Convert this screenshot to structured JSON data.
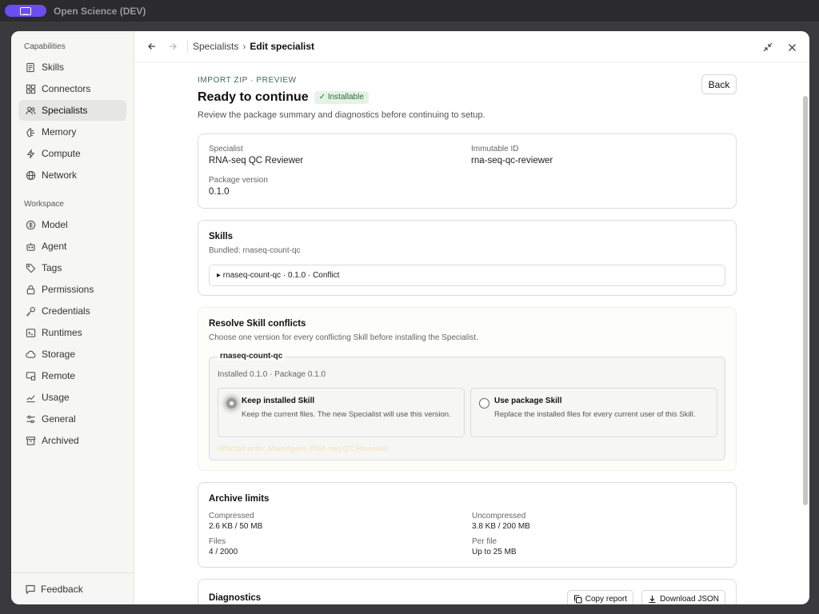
{
  "os": {
    "title": "Open Science (DEV)"
  },
  "sidebar": {
    "capabilities_label": "Capabilities",
    "capabilities": [
      {
        "label": "Skills",
        "icon": "skills-icon"
      },
      {
        "label": "Connectors",
        "icon": "connectors-icon"
      },
      {
        "label": "Specialists",
        "icon": "specialists-icon",
        "active": true
      },
      {
        "label": "Memory",
        "icon": "memory-icon"
      },
      {
        "label": "Compute",
        "icon": "compute-icon"
      },
      {
        "label": "Network",
        "icon": "network-icon"
      }
    ],
    "workspace_label": "Workspace",
    "workspace": [
      {
        "label": "Model",
        "icon": "model-icon"
      },
      {
        "label": "Agent",
        "icon": "agent-icon"
      },
      {
        "label": "Tags",
        "icon": "tags-icon"
      },
      {
        "label": "Permissions",
        "icon": "permissions-icon"
      },
      {
        "label": "Credentials",
        "icon": "credentials-icon"
      },
      {
        "label": "Runtimes",
        "icon": "runtimes-icon"
      },
      {
        "label": "Storage",
        "icon": "storage-icon"
      },
      {
        "label": "Remote",
        "icon": "remote-icon"
      },
      {
        "label": "Usage",
        "icon": "usage-icon"
      },
      {
        "label": "General",
        "icon": "general-icon"
      },
      {
        "label": "Archived",
        "icon": "archived-icon"
      }
    ],
    "feedback_label": "Feedback"
  },
  "topbar": {
    "breadcrumb": [
      "Specialists",
      "Edit specialist"
    ]
  },
  "page": {
    "eyebrow": "IMPORT ZIP · PREVIEW",
    "title": "Ready to continue",
    "badge": "✓ Installable",
    "subtitle": "Review the package summary and diagnostics before continuing to setup.",
    "back_label": "Back"
  },
  "summary": {
    "specialist_label": "Specialist",
    "specialist_value": "RNA-seq QC Reviewer",
    "immutable_label": "Immutable ID",
    "immutable_value": "rna-seq-qc-reviewer",
    "version_label": "Package version",
    "version_value": "0.1.0"
  },
  "skills": {
    "title": "Skills",
    "bundled": "Bundled: rnaseq-count-qc",
    "row": "▸ rnaseq-count-qc · 0.1.0 · Conflict"
  },
  "conflicts": {
    "title": "Resolve Skill conflicts",
    "desc": "Choose one version for every conflicting Skill before installing the Specialist.",
    "skill_name": "rnaseq-count-qc",
    "versions": "Installed 0.1.0 · Package 0.1.0",
    "options": [
      {
        "title": "Keep installed Skill",
        "desc": "Keep the current files. The new Specialist will use this version.",
        "checked": true
      },
      {
        "title": "Use package Skill",
        "desc": "Replace the installed files for every current user of this Skill.",
        "checked": false
      }
    ],
    "affected": "Affected units: Main Agent, RNA-seq QC Reviewer"
  },
  "limits": {
    "title": "Archive limits",
    "compressed_label": "Compressed",
    "compressed_value": "2.6 KB / 50 MB",
    "uncompressed_label": "Uncompressed",
    "uncompressed_value": "3.8 KB / 200 MB",
    "files_label": "Files",
    "files_value": "4 / 2000",
    "perfile_label": "Per file",
    "perfile_value": "Up to 25 MB"
  },
  "diagnostics": {
    "title": "Diagnostics",
    "copy_label": "Copy report",
    "download_label": "Download JSON"
  },
  "colors": {
    "accent": "#6b4ef0",
    "success_bg": "#e5f2e6",
    "success_text": "#2f6b3a"
  }
}
